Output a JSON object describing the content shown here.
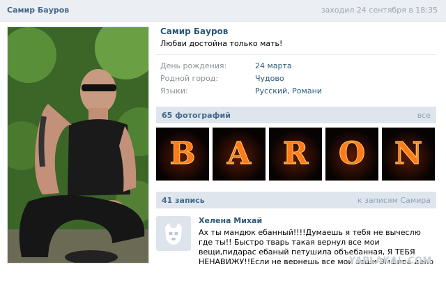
{
  "header": {
    "name": "Самир Бауров",
    "last_seen": "заходил 24 сентября в 18:35"
  },
  "profile": {
    "name": "Самир Бауров",
    "status": "Любви достойна только мать!",
    "info": [
      {
        "label": "День рождения:",
        "value": "24 марта"
      },
      {
        "label": "Родной город:",
        "value": "Чудово"
      },
      {
        "label": "Языки:",
        "value": "Русский, Романи"
      }
    ]
  },
  "photos": {
    "title": "65 фотографий",
    "link": "все",
    "letters": [
      "B",
      "A",
      "R",
      "O",
      "N"
    ]
  },
  "wall": {
    "title": "41 запись",
    "link": "к записям Самира",
    "post": {
      "author": "Хелена Михай",
      "text": "Ах ты мандюк ебанный!!!!Думаешь я тебя не вычеслю где ты!! Быстро тварь такая вернул все мои вещи,пидарас ебаный петушила объебанная, Я ТЕБЯ НЕНАВИЖУ!!Если не вернешь все мои вещи Эмфира дело откроет"
    }
  },
  "watermark": "YAPLAKAL.COM",
  "colors": {
    "link": "#2b587a",
    "header_bg": "#dee5ed",
    "label": "#8a8f94"
  }
}
